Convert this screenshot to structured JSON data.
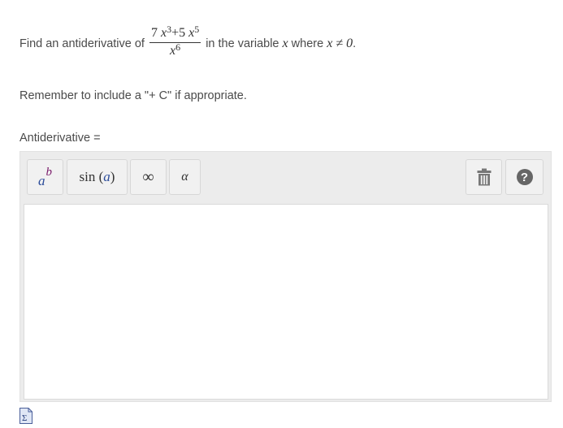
{
  "question": {
    "prefix": "Find an antiderivative of",
    "numerator": {
      "coef1": "7",
      "var1": "x",
      "exp1": "3",
      "plus": "+5",
      "var2": "x",
      "exp2": "5"
    },
    "denominator": {
      "var": "x",
      "exp": "6"
    },
    "middle": "in the variable",
    "variable": "x",
    "where": "where",
    "condition": "x ≠ 0",
    "period": "."
  },
  "reminder": "Remember to include a \"+ C\" if appropriate.",
  "answer_label": "Antiderivative =",
  "toolbar": {
    "power": {
      "base": "a",
      "exp": "b"
    },
    "sin": {
      "fn": "sin",
      "open": "(",
      "arg": "a",
      "close": ")"
    },
    "infinity": "∞",
    "alpha": "α",
    "trash_icon": "trash-icon",
    "help_icon": "help-icon",
    "help_glyph": "?"
  },
  "answer_value": "",
  "footer_icon": "math-document-icon"
}
